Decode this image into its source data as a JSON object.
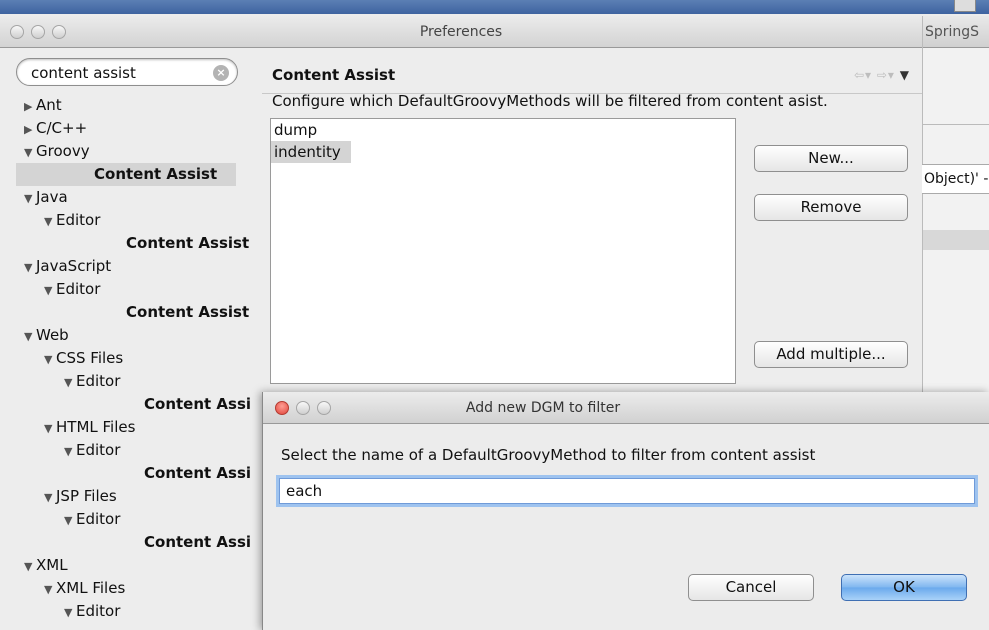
{
  "prefs": {
    "title": "Preferences",
    "filter_value": "content assist",
    "tree": [
      {
        "label": "Ant",
        "arrow": "▶",
        "bold": false,
        "indent": 0
      },
      {
        "label": "C/C++",
        "arrow": "▶",
        "bold": false,
        "indent": 0
      },
      {
        "label": "Groovy",
        "arrow": "▼",
        "bold": false,
        "indent": 0
      },
      {
        "label": "Content Assist",
        "arrow": "",
        "bold": true,
        "indent": 2,
        "selected": true
      },
      {
        "label": "Java",
        "arrow": "▼",
        "bold": false,
        "indent": 0
      },
      {
        "label": "Editor",
        "arrow": "▼",
        "bold": false,
        "indent": 1
      },
      {
        "label": "Content Assist",
        "arrow": "",
        "bold": true,
        "indent": 3
      },
      {
        "label": "JavaScript",
        "arrow": "▼",
        "bold": false,
        "indent": 0
      },
      {
        "label": "Editor",
        "arrow": "▼",
        "bold": false,
        "indent": 1
      },
      {
        "label": "Content Assist",
        "arrow": "",
        "bold": true,
        "indent": 3
      },
      {
        "label": "Web",
        "arrow": "▼",
        "bold": false,
        "indent": 0
      },
      {
        "label": "CSS Files",
        "arrow": "▼",
        "bold": false,
        "indent": 1
      },
      {
        "label": "Editor",
        "arrow": "▼",
        "bold": false,
        "indent": 2
      },
      {
        "label": "Content Assist",
        "arrow": "",
        "bold": true,
        "indent": 4
      },
      {
        "label": "HTML Files",
        "arrow": "▼",
        "bold": false,
        "indent": 1
      },
      {
        "label": "Editor",
        "arrow": "▼",
        "bold": false,
        "indent": 2
      },
      {
        "label": "Content Assist",
        "arrow": "",
        "bold": true,
        "indent": 4
      },
      {
        "label": "JSP Files",
        "arrow": "▼",
        "bold": false,
        "indent": 1
      },
      {
        "label": "Editor",
        "arrow": "▼",
        "bold": false,
        "indent": 2
      },
      {
        "label": "Content Assist",
        "arrow": "",
        "bold": true,
        "indent": 4
      },
      {
        "label": "XML",
        "arrow": "▼",
        "bold": false,
        "indent": 0
      },
      {
        "label": "XML Files",
        "arrow": "▼",
        "bold": false,
        "indent": 1
      },
      {
        "label": "Editor",
        "arrow": "▼",
        "bold": false,
        "indent": 2
      }
    ],
    "page": {
      "title": "Content Assist",
      "description": "Configure which DefaultGroovyMethods will be filtered from content asist.",
      "list_items": [
        "dump",
        "indentity"
      ],
      "selected_item": "indentity",
      "new_button": "New...",
      "remove_button": "Remove",
      "add_multiple_button": "Add multiple..."
    }
  },
  "background_window": {
    "title_fragment": "SpringS",
    "obj_fragment": "Object)' -"
  },
  "dialog": {
    "title": "Add new DGM to filter",
    "prompt": "Select the name of a DefaultGroovyMethod to filter from content assist",
    "input_value": "each",
    "cancel_button": "Cancel",
    "ok_button": "OK"
  }
}
